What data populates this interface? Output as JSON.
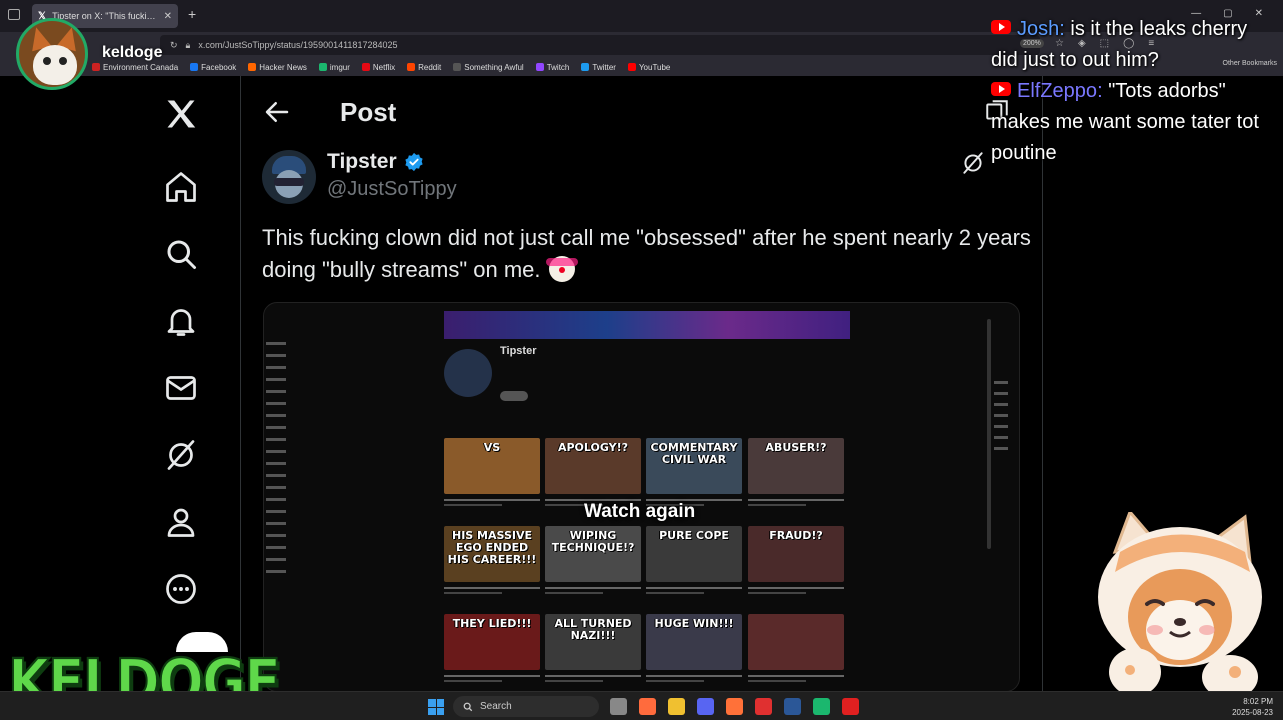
{
  "browser": {
    "tab_title": "Tipster on X: \"This fucking clow",
    "url": "x.com/JustSoTippy/status/1959001411817284025",
    "zoom": "200%",
    "bookmarks": [
      "Environment Canada",
      "Facebook",
      "Hacker News",
      "imgur",
      "Netflix",
      "Reddit",
      "Something Awful",
      "Twitch",
      "Twitter",
      "YouTube"
    ],
    "other_bookmarks": "Other Bookmarks",
    "bookmark_colors": [
      "#cc2222",
      "#1877f2",
      "#ff6600",
      "#1bb76e",
      "#e50914",
      "#ff4500",
      "#555555",
      "#9146ff",
      "#1d9bf0",
      "#ff0000"
    ]
  },
  "streamer": {
    "name": "keldoge",
    "logo_text": "KELDOGE"
  },
  "x": {
    "nav_icons": [
      "x-logo-icon",
      "home-icon",
      "search-icon",
      "notifications-icon",
      "messages-icon",
      "grok-icon",
      "profile-icon",
      "more-icon"
    ],
    "header_title": "Post",
    "author_name": "Tipster",
    "author_handle": "@JustSoTippy",
    "tweet_text": "This fucking clown did not just call me \"obsessed\" after he spent nearly 2 years doing \"bully streams\" on me.",
    "accent": "#1d9bf0"
  },
  "video": {
    "channel_name": "Tipster",
    "overlay_label": "Watch again",
    "thumbnails": [
      {
        "text": "VS",
        "color": "#8a5a2a"
      },
      {
        "text": "APOLOGY!?",
        "color": "#5a3a2a"
      },
      {
        "text": "COMMENTARY CIVIL WAR",
        "color": "#3a4a5a"
      },
      {
        "text": "ABUSER!?",
        "color": "#4a3a3a"
      },
      {
        "text": "HIS MASSIVE EGO ENDED HIS CAREER!!!",
        "color": "#5a4020"
      },
      {
        "text": "WIPING TECHNIQUE!?",
        "color": "#4a4a4a"
      },
      {
        "text": "PURE COPE",
        "color": "#3a3a3a"
      },
      {
        "text": "FRAUD!?",
        "color": "#4a2a2a"
      },
      {
        "text": "THEY LIED!!!",
        "color": "#6a1a1a"
      },
      {
        "text": "ALL TURNED NAZI!!!",
        "color": "#3a3a3a"
      },
      {
        "text": "HUGE WIN!!!",
        "color": "#3a3a4a"
      },
      {
        "text": "",
        "color": "#5a2a2a"
      }
    ]
  },
  "chat": [
    {
      "user": "Josh",
      "message": "is it the leaks cherry did just to out him?"
    },
    {
      "user": "ElfZeppo",
      "message": "\"Tots adorbs\" makes me want some tater tot poutine"
    }
  ],
  "taskbar": {
    "search_placeholder": "Search",
    "time": "8:02 PM",
    "date": "2025-08-23",
    "app_colors": [
      "#888888",
      "#ff6b3d",
      "#f0c030",
      "#5865f2",
      "#ff7139",
      "#e03030",
      "#2b5797",
      "#1bb76e",
      "#e02020"
    ]
  }
}
